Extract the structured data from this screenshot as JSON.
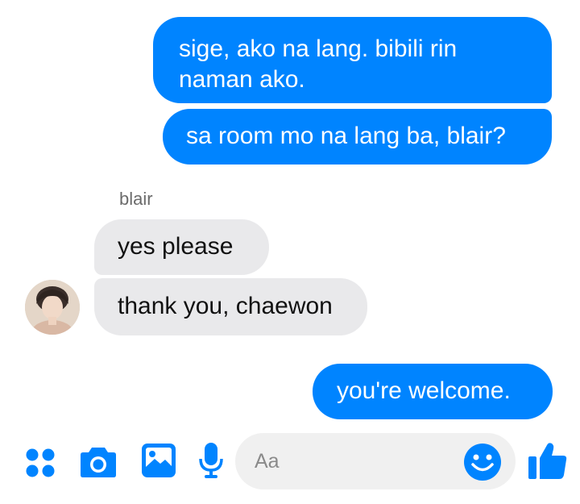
{
  "conversation": {
    "messages": [
      {
        "direction": "outgoing",
        "text": "sige, ako na lang. bibili rin naman ako."
      },
      {
        "direction": "outgoing",
        "text": "sa room mo na lang ba, blair?"
      },
      {
        "direction": "incoming",
        "sender": "blair",
        "text": "yes please"
      },
      {
        "direction": "incoming",
        "sender": "blair",
        "text": "thank you, chaewon"
      },
      {
        "direction": "outgoing",
        "text": "you're welcome."
      }
    ],
    "incoming_sender_name": "blair"
  },
  "composer": {
    "placeholder": "Aa",
    "icons": [
      "apps-icon",
      "camera-icon",
      "gallery-icon",
      "microphone-icon",
      "emoji-icon",
      "thumbs-up-icon"
    ]
  },
  "colors": {
    "accent": "#0084ff",
    "incoming_bubble": "#e9e9eb",
    "outgoing_text": "#ffffff",
    "incoming_text": "#111111"
  }
}
